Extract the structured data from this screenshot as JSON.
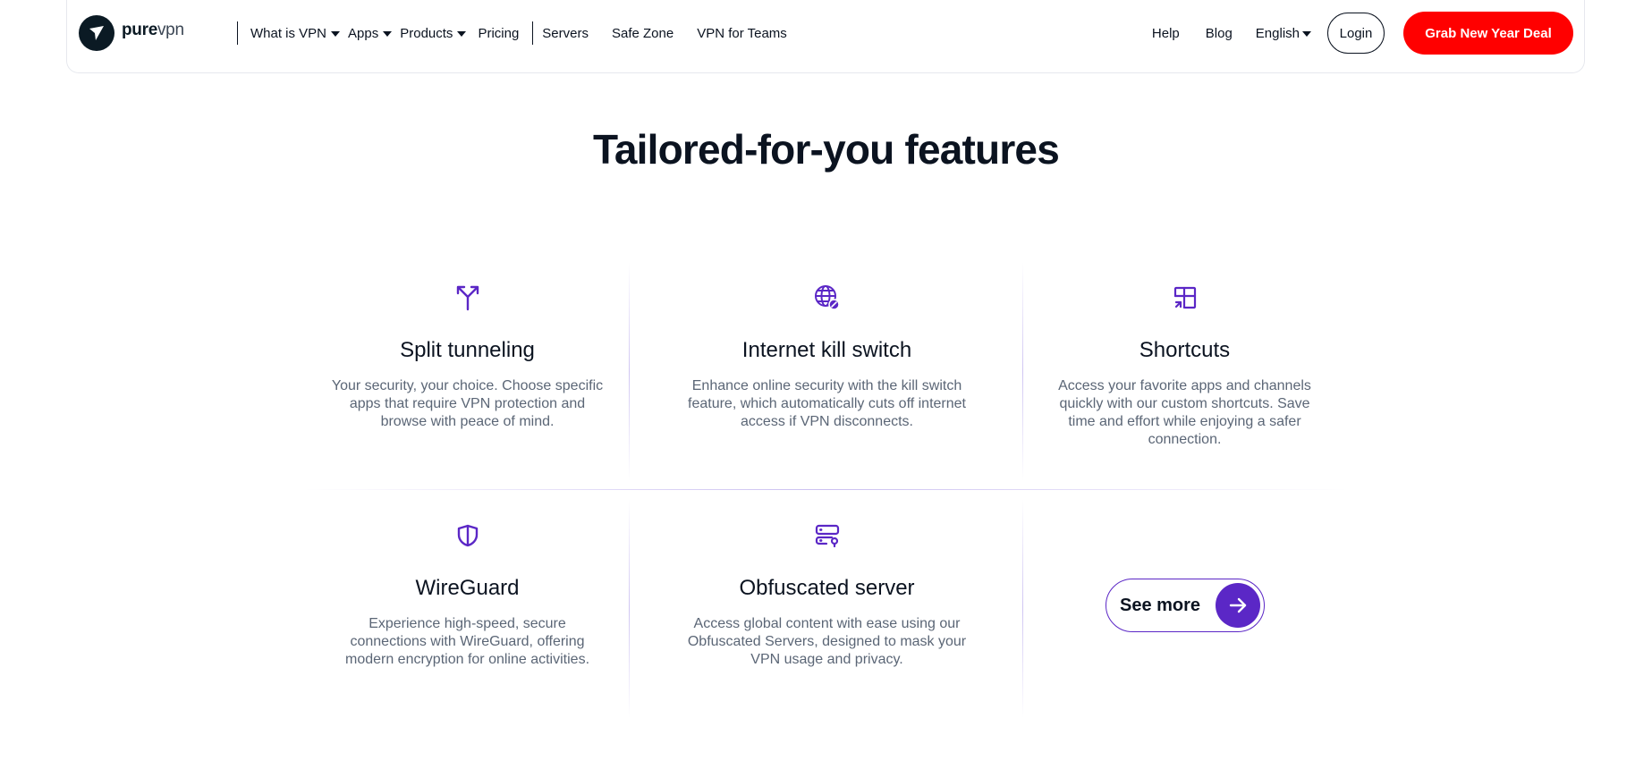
{
  "brand": {
    "name_bold": "pure",
    "name_light": "vpn",
    "accent": "#5b27c6",
    "cta_color": "#ff0000"
  },
  "nav": {
    "left": [
      {
        "label": "What is VPN",
        "dropdown": true
      },
      {
        "label": "Apps",
        "dropdown": true
      },
      {
        "label": "Products",
        "dropdown": true
      },
      {
        "label": "Pricing",
        "dropdown": false
      }
    ],
    "secondary": [
      {
        "label": "Servers"
      },
      {
        "label": "Safe Zone"
      },
      {
        "label": "VPN for Teams"
      }
    ],
    "right": {
      "help": "Help",
      "blog": "Blog",
      "language": "English",
      "login": "Login",
      "deal": "Grab New Year Deal"
    }
  },
  "section": {
    "title": "Tailored-for-you features"
  },
  "features": [
    {
      "icon": "split-icon",
      "title": "Split tunneling",
      "description": "Your security, your choice. Choose specific apps that require VPN protection and browse with peace of mind."
    },
    {
      "icon": "globe-block-icon",
      "title": "Internet kill switch",
      "description": "Enhance online security with the kill switch feature, which automatically cuts off internet access if VPN disconnects."
    },
    {
      "icon": "shortcut-icon",
      "title": "Shortcuts",
      "description": "Access your favorite apps and channels quickly with our custom shortcuts. Save time and effort while enjoying a safer connection."
    },
    {
      "icon": "shield-icon",
      "title": "WireGuard",
      "description": "Experience high-speed, secure connections with WireGuard, offering modern encryption for online activities."
    },
    {
      "icon": "server-icon",
      "title": "Obfuscated server",
      "description": "Access global content with ease using our Obfuscated Servers, designed to mask your VPN usage and privacy."
    }
  ],
  "see_more": {
    "label": "See more",
    "icon": "arrow-right-icon"
  }
}
